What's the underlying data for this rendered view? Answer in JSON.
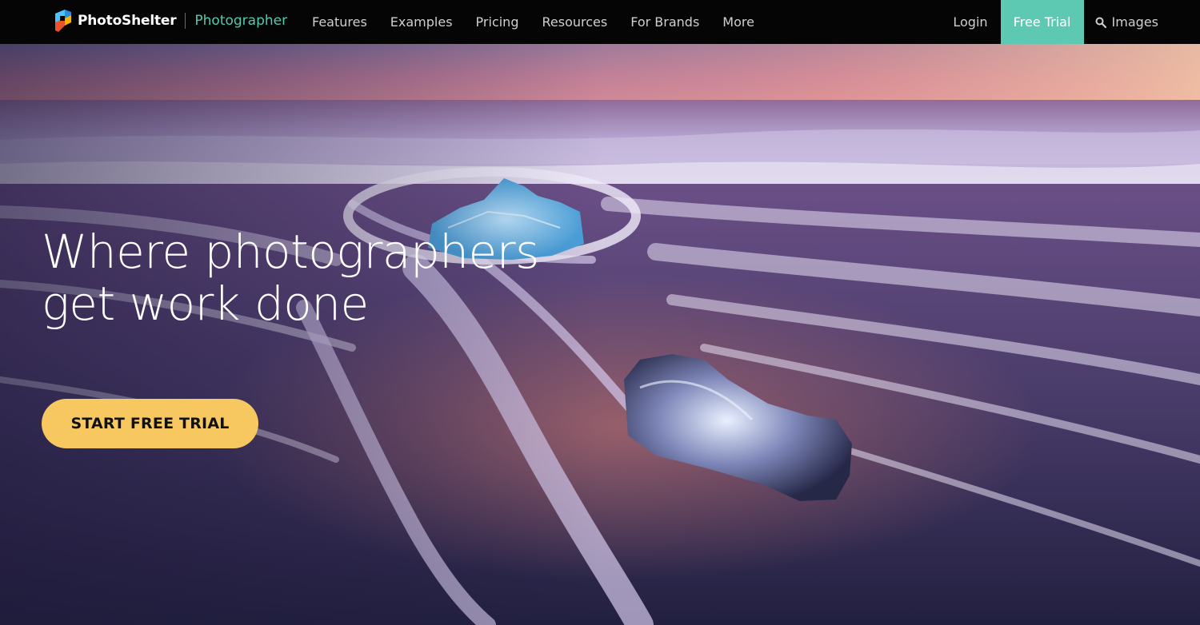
{
  "brand": {
    "name": "PhotoShelter",
    "product": "Photographer",
    "logo_icon": "photoshelter-logo-icon"
  },
  "nav": {
    "items": [
      {
        "label": "Features"
      },
      {
        "label": "Examples"
      },
      {
        "label": "Pricing"
      },
      {
        "label": "Resources"
      },
      {
        "label": "For Brands"
      },
      {
        "label": "More"
      }
    ],
    "login": "Login",
    "free_trial": "Free Trial",
    "images": "Images",
    "images_icon": "search-icon"
  },
  "hero": {
    "headline": "Where photographers get work done",
    "cta": "START FREE TRIAL",
    "image": "long-exposure photo of ice chunks on black sand beach at sunset"
  },
  "colors": {
    "nav_bg": "#050505",
    "accent_teal": "#5ec9b2",
    "product_teal": "#4ecbb2",
    "cta_yellow": "#f6c85f"
  }
}
